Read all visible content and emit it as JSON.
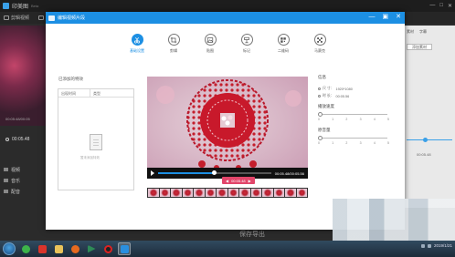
{
  "background_app": {
    "title": "印美图",
    "title_suffix": "Beta",
    "toolbar": [
      "剪辑视频",
      "素材",
      "音乐",
      "字幕",
      "特效"
    ],
    "preview_caption": "00:05:48/00:05",
    "current_time": "00:05.48",
    "tracks": [
      "视频",
      "音乐",
      "配音"
    ],
    "right_panel_heads": [
      "素材",
      "字幕",
      "配音"
    ],
    "right_panel_button": "添加素材",
    "right_panel_time": "00:05.48",
    "save_button": "保存导出"
  },
  "dialog": {
    "title": "编辑视频片段",
    "tabs": [
      {
        "label": "基础设置",
        "icon": "scissors-icon",
        "active": true
      },
      {
        "label": "剪辑",
        "icon": "crop-icon",
        "active": false
      },
      {
        "label": "贴图",
        "icon": "image-icon",
        "active": false
      },
      {
        "label": "标记",
        "icon": "tag-icon",
        "active": false
      },
      {
        "label": "二维码",
        "icon": "qrcode-icon",
        "active": false
      },
      {
        "label": "马赛克",
        "icon": "mosaic-icon",
        "active": false
      }
    ],
    "added_effects": {
      "label": "已添加的特效",
      "columns": [
        "出现时间",
        "类型"
      ],
      "empty_text": "暂未添加特效"
    },
    "player": {
      "time_display": "00:05.48/00:05.56",
      "progress": 0.5,
      "current_marker": "00:05.48"
    },
    "info": {
      "heading": "信息",
      "size_label": "尺 寸：",
      "size_value": "1920*1080",
      "duration_label": "时 长：",
      "duration_value": "00:05.56",
      "speed_heading": "播放速度",
      "volume_heading": "原音量",
      "ticks": [
        "0",
        "1",
        "2",
        "3",
        "4",
        "5"
      ]
    }
  },
  "taskbar": {
    "apps": [
      "start",
      "qq-browser",
      "security",
      "file-explorer",
      "firefox",
      "video-player",
      "recorder",
      "editor"
    ],
    "date": "2019/1/21"
  }
}
